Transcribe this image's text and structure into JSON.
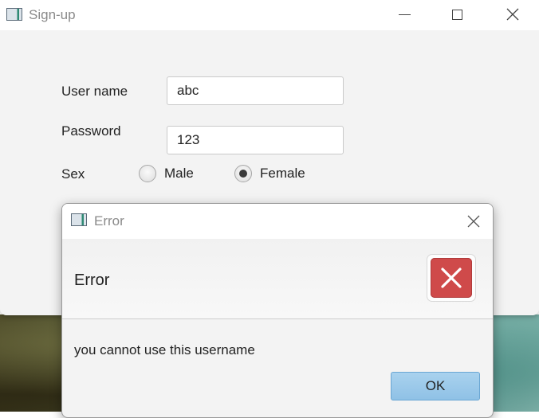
{
  "main_window": {
    "title": "Sign-up",
    "controls": {
      "minimize": "minimize-icon",
      "maximize": "maximize-icon",
      "close": "close-icon"
    }
  },
  "form": {
    "username_label": "User name",
    "username_value": "abc",
    "password_label": "Password",
    "password_value": "123",
    "sex_label": "Sex",
    "sex_options": [
      {
        "label": "Male",
        "selected": false
      },
      {
        "label": "Female",
        "selected": true
      }
    ]
  },
  "dialog": {
    "title": "Error",
    "header_text": "Error",
    "message": "you cannot use this username",
    "ok_label": "OK",
    "icon": "error-icon",
    "colors": {
      "error_red": "#cf4a4a",
      "ok_button": "#9ccbea"
    }
  }
}
